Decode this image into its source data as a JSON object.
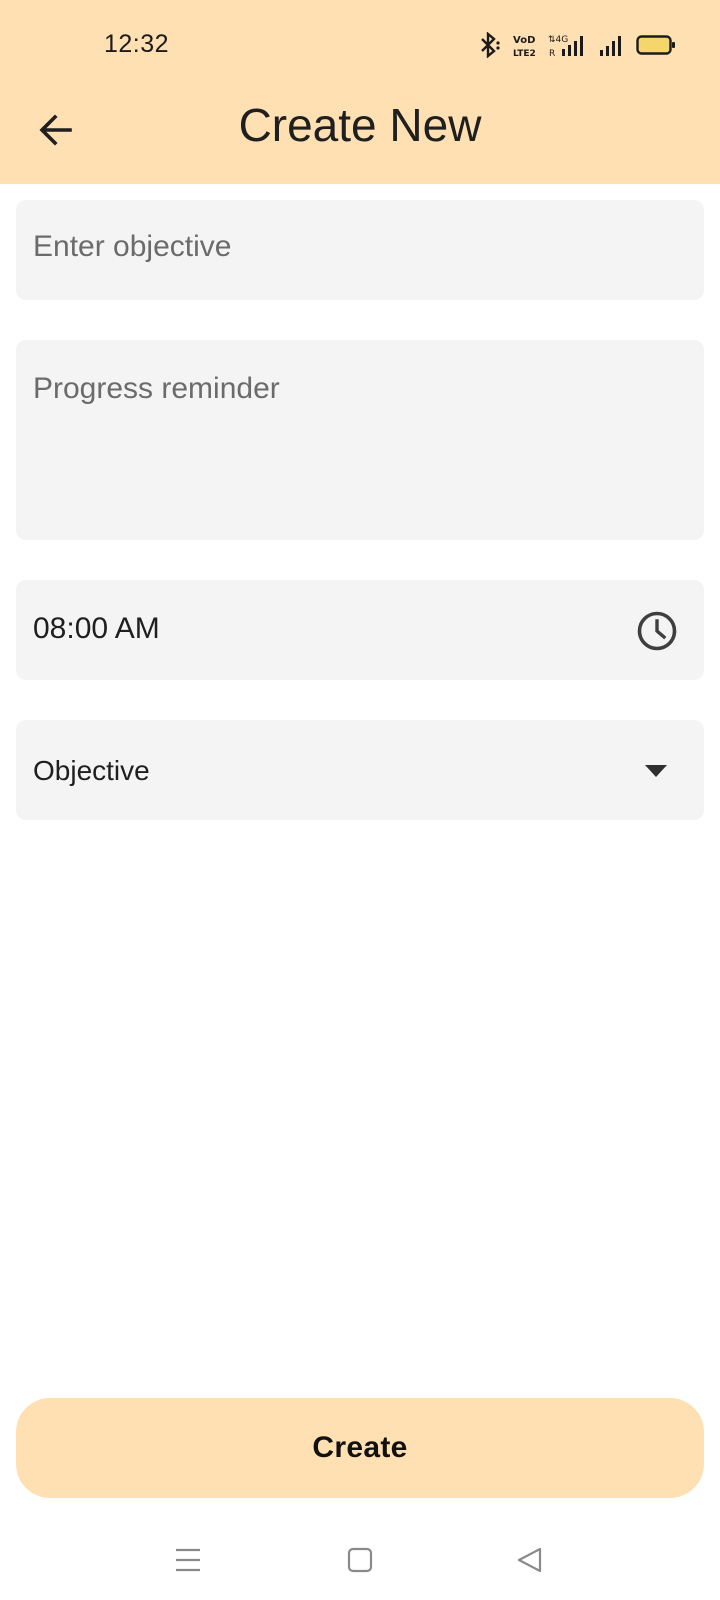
{
  "status_bar": {
    "time": "12:32",
    "icons": [
      "bluetooth-icon",
      "volte-icon",
      "4g-signal-icon",
      "signal-icon",
      "battery-icon"
    ],
    "volte_label": "VoD LTE2",
    "network_label": "4G",
    "battery_color": "#f6d66b"
  },
  "header": {
    "title": "Create New",
    "back_icon": "arrow-left-icon",
    "background": "#ffe0b2"
  },
  "form": {
    "objective_input": {
      "placeholder": "Enter objective",
      "value": ""
    },
    "reminder_input": {
      "placeholder": "Progress reminder",
      "value": ""
    },
    "time_field": {
      "value": "08:00 AM",
      "icon": "clock-icon"
    },
    "category_select": {
      "selected": "Objective",
      "icon": "dropdown-arrow-icon"
    }
  },
  "actions": {
    "create_label": "Create",
    "create_color": "#ffe0b2"
  },
  "nav_bar": {
    "icons": [
      "menu-icon",
      "home-icon",
      "back-triangle-icon"
    ]
  }
}
